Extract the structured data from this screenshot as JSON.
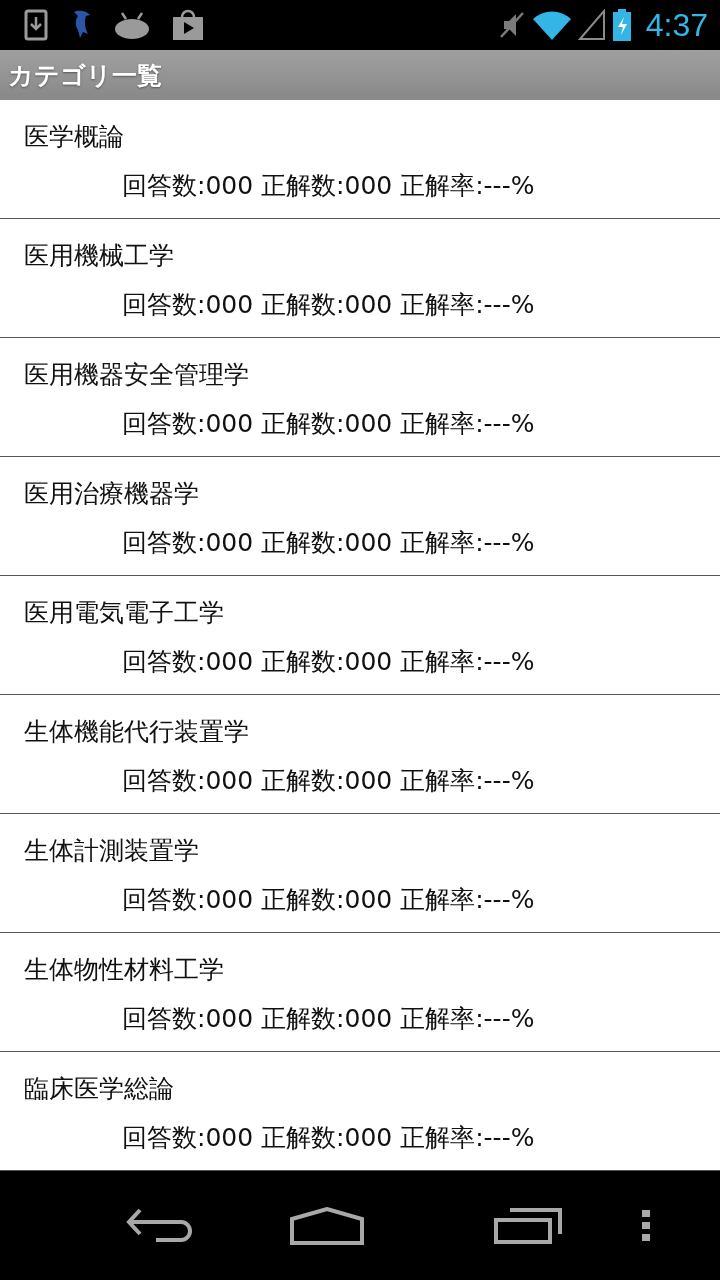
{
  "status_bar": {
    "time": "4:37"
  },
  "title": "カテゴリ一覧",
  "categories": [
    {
      "name": "医学概論",
      "stats": "回答数:000 正解数:000 正解率:---%"
    },
    {
      "name": "医用機械工学",
      "stats": "回答数:000 正解数:000 正解率:---%"
    },
    {
      "name": "医用機器安全管理学",
      "stats": "回答数:000 正解数:000 正解率:---%"
    },
    {
      "name": "医用治療機器学",
      "stats": "回答数:000 正解数:000 正解率:---%"
    },
    {
      "name": "医用電気電子工学",
      "stats": "回答数:000 正解数:000 正解率:---%"
    },
    {
      "name": "生体機能代行装置学",
      "stats": "回答数:000 正解数:000 正解率:---%"
    },
    {
      "name": "生体計測装置学",
      "stats": "回答数:000 正解数:000 正解率:---%"
    },
    {
      "name": "生体物性材料工学",
      "stats": "回答数:000 正解数:000 正解率:---%"
    },
    {
      "name": "臨床医学総論",
      "stats": "回答数:000 正解数:000 正解率:---%"
    }
  ]
}
